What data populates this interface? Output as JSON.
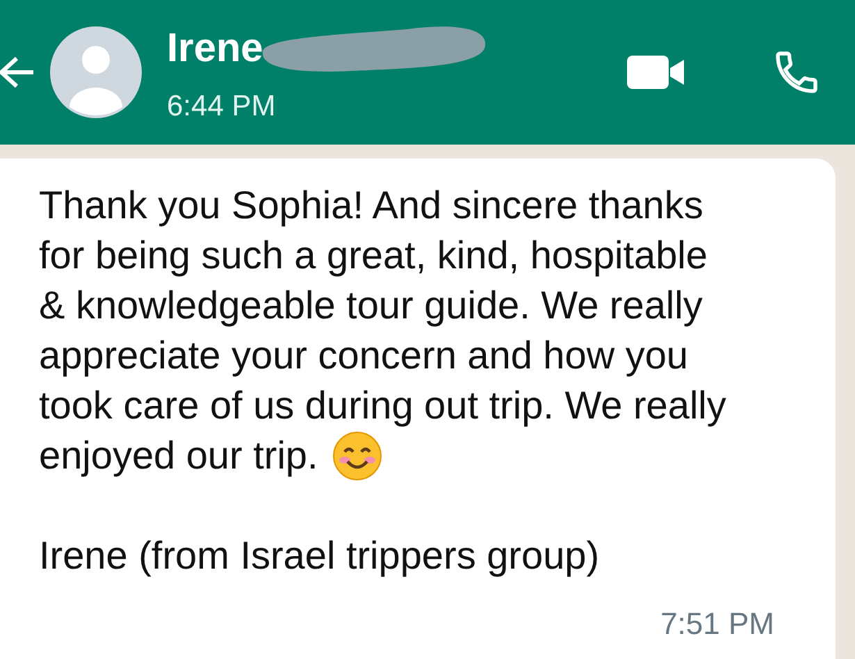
{
  "header": {
    "contact_name": "Irene",
    "last_seen": "6:44 PM"
  },
  "message": {
    "paragraphs": [
      {
        "text": "Thank you Sophia! And sincere thanks\nfor being such a great, kind, hospitable\n& knowledgeable tour guide. We really\nappreciate your concern and how you\ntook care of us during out trip. We really",
        "last_line": "enjoyed our trip."
      },
      {
        "text": "Irene (from Israel trippers group)"
      }
    ],
    "time": "7:51 PM"
  }
}
